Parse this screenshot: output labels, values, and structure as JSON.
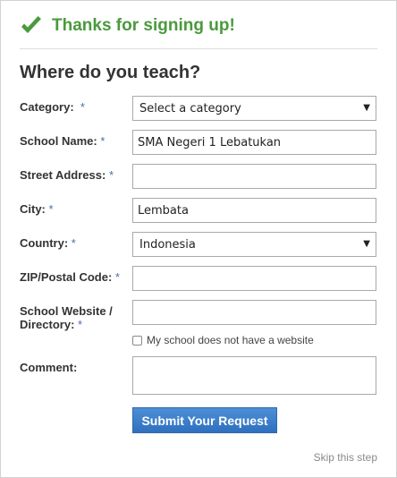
{
  "success": {
    "message": "Thanks for signing up!",
    "icon": "check-icon",
    "color": "#4a9a3c"
  },
  "form": {
    "heading": "Where do you teach?",
    "required_mark": "*",
    "category": {
      "label": "Category:",
      "value": "Select a category"
    },
    "school_name": {
      "label": "School Name:",
      "value": "SMA Negeri 1 Lebatukan"
    },
    "street_address": {
      "label": "Street Address:",
      "value": ""
    },
    "city": {
      "label": "City:",
      "value": "Lembata"
    },
    "country": {
      "label": "Country:",
      "value": "Indonesia"
    },
    "zip": {
      "label": "ZIP/Postal Code:",
      "value": ""
    },
    "website": {
      "label_line1": "School Website /",
      "label_line2": "Directory:",
      "value": ""
    },
    "no_website": {
      "label": "My school does not have a website",
      "checked": false
    },
    "comment": {
      "label": "Comment:",
      "value": ""
    },
    "submit_label": "Submit Your Request",
    "skip_label": "Skip this step"
  }
}
